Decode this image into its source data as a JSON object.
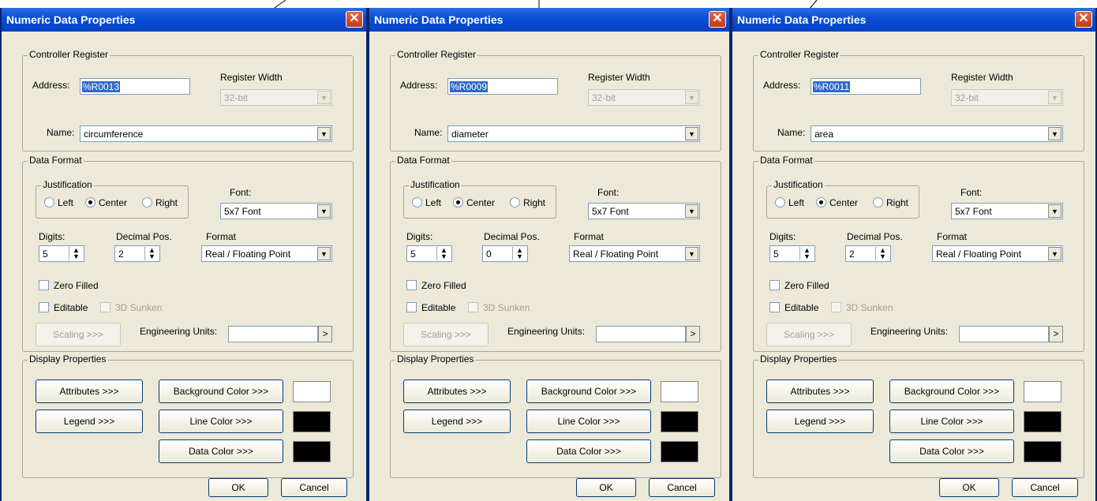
{
  "colors": {
    "title_bar": "#0a4fd6",
    "dialog_bg": "#ece9d8",
    "close_button": "#d5492a",
    "selection": "#316ac5"
  },
  "dialogs": [
    {
      "title": "Numeric Data Properties",
      "controller_register": {
        "legend": "Controller Register",
        "address_label": "Address:",
        "address_value": "%R0013",
        "register_width_label": "Register Width",
        "register_width_value": "32-bit",
        "name_label": "Name:",
        "name_value": "circumference"
      },
      "data_format": {
        "legend": "Data Format",
        "justification_legend": "Justification",
        "justification_options": [
          "Left",
          "Center",
          "Right"
        ],
        "justification_selected": "Center",
        "font_label": "Font:",
        "font_value": "5x7 Font",
        "digits_label": "Digits:",
        "digits_value": "5",
        "decimal_label": "Decimal Pos.",
        "decimal_value": "2",
        "format_label": "Format",
        "format_value": "Real / Floating Point",
        "zero_filled": "Zero Filled",
        "editable": "Editable",
        "sunken": "3D Sunken",
        "scaling_button": "Scaling >>>",
        "engineering_units_label": "Engineering Units:",
        "engineering_units_button": ">"
      },
      "display_properties": {
        "legend": "Display Properties",
        "attributes_button": "Attributes >>>",
        "legend_button": "Legend >>>",
        "background_color_button": "Background Color >>>",
        "line_color_button": "Line Color >>>",
        "data_color_button": "Data Color >>>",
        "background_color": "#ffffff",
        "line_color": "#000000",
        "data_color": "#000000"
      },
      "ok_button": "OK",
      "cancel_button": "Cancel",
      "close_icon": "close-icon"
    },
    {
      "title": "Numeric Data Properties",
      "controller_register": {
        "legend": "Controller Register",
        "address_label": "Address:",
        "address_value": "%R0009",
        "register_width_label": "Register Width",
        "register_width_value": "32-bit",
        "name_label": "Name:",
        "name_value": "diameter"
      },
      "data_format": {
        "legend": "Data Format",
        "justification_legend": "Justification",
        "justification_options": [
          "Left",
          "Center",
          "Right"
        ],
        "justification_selected": "Center",
        "font_label": "Font:",
        "font_value": "5x7 Font",
        "digits_label": "Digits:",
        "digits_value": "5",
        "decimal_label": "Decimal Pos.",
        "decimal_value": "0",
        "format_label": "Format",
        "format_value": "Real / Floating Point",
        "zero_filled": "Zero Filled",
        "editable": "Editable",
        "sunken": "3D Sunken",
        "scaling_button": "Scaling >>>",
        "engineering_units_label": "Engineering Units:",
        "engineering_units_button": ">"
      },
      "display_properties": {
        "legend": "Display Properties",
        "attributes_button": "Attributes >>>",
        "legend_button": "Legend >>>",
        "background_color_button": "Background Color >>>",
        "line_color_button": "Line Color >>>",
        "data_color_button": "Data Color >>>",
        "background_color": "#ffffff",
        "line_color": "#000000",
        "data_color": "#000000"
      },
      "ok_button": "OK",
      "cancel_button": "Cancel",
      "close_icon": "close-icon"
    },
    {
      "title": "Numeric Data Properties",
      "controller_register": {
        "legend": "Controller Register",
        "address_label": "Address:",
        "address_value": "%R0011",
        "register_width_label": "Register Width",
        "register_width_value": "32-bit",
        "name_label": "Name:",
        "name_value": "area"
      },
      "data_format": {
        "legend": "Data Format",
        "justification_legend": "Justification",
        "justification_options": [
          "Left",
          "Center",
          "Right"
        ],
        "justification_selected": "Center",
        "font_label": "Font:",
        "font_value": "5x7 Font",
        "digits_label": "Digits:",
        "digits_value": "5",
        "decimal_label": "Decimal Pos.",
        "decimal_value": "2",
        "format_label": "Format",
        "format_value": "Real / Floating Point",
        "zero_filled": "Zero Filled",
        "editable": "Editable",
        "sunken": "3D Sunken",
        "scaling_button": "Scaling >>>",
        "engineering_units_label": "Engineering Units:",
        "engineering_units_button": ">"
      },
      "display_properties": {
        "legend": "Display Properties",
        "attributes_button": "Attributes >>>",
        "legend_button": "Legend >>>",
        "background_color_button": "Background Color >>>",
        "line_color_button": "Line Color >>>",
        "data_color_button": "Data Color >>>",
        "background_color": "#ffffff",
        "line_color": "#000000",
        "data_color": "#000000"
      },
      "ok_button": "OK",
      "cancel_button": "Cancel",
      "close_icon": "close-icon"
    }
  ]
}
